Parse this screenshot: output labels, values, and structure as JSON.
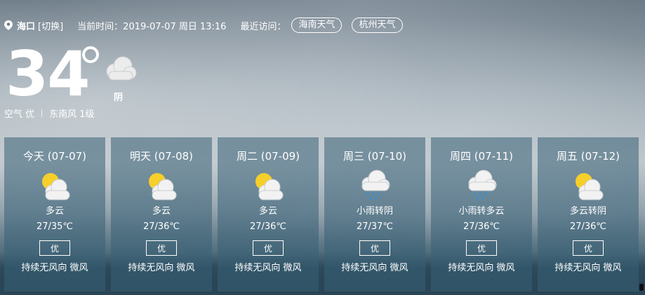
{
  "header": {
    "city": "海口",
    "switch_label": "[切换]",
    "time_label": "当前时间：2019-07-07   周日   13:16",
    "recent_label": "最近访问：",
    "recent_links": [
      "海南天气",
      "杭州天气"
    ]
  },
  "current": {
    "temperature": "34",
    "icon": "cloudy-icon",
    "condition": "阴",
    "air_quality": "空气 优",
    "wind": "东南风 1级"
  },
  "forecast": [
    {
      "day": "今天 (07-07)",
      "icon": "partly-cloudy-icon",
      "condition": "多云",
      "temp": "27/35℃",
      "aqi": "优",
      "wind": "持续无风向 微风"
    },
    {
      "day": "明天 (07-08)",
      "icon": "partly-cloudy-icon",
      "condition": "多云",
      "temp": "27/36℃",
      "aqi": "优",
      "wind": "持续无风向 微风"
    },
    {
      "day": "周二 (07-09)",
      "icon": "partly-cloudy-icon",
      "condition": "多云",
      "temp": "27/36℃",
      "aqi": "优",
      "wind": "持续无风向 微风"
    },
    {
      "day": "周三 (07-10)",
      "icon": "light-rain-icon",
      "condition": "小雨转阴",
      "temp": "27/37℃",
      "aqi": "优",
      "wind": "持续无风向 微风"
    },
    {
      "day": "周四 (07-11)",
      "icon": "light-rain-icon",
      "condition": "小雨转多云",
      "temp": "27/36℃",
      "aqi": "优",
      "wind": "持续无风向 微风"
    },
    {
      "day": "周五 (07-12)",
      "icon": "partly-cloudy-icon",
      "condition": "多云转阴",
      "temp": "27/36℃",
      "aqi": "优",
      "wind": "持续无风向 微风"
    }
  ]
}
